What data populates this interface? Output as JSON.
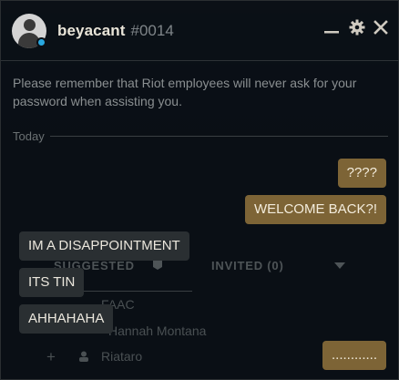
{
  "header": {
    "username": "beyacant",
    "tag": "#0014",
    "status_color": "#29a8e0"
  },
  "controls": {
    "minimize_icon": "minimize-icon",
    "settings_icon": "gear-icon",
    "close_icon": "close-icon"
  },
  "notice": "Please remember that Riot employees will never ask for your password when assisting you.",
  "divider_label": "Today",
  "background_list": {
    "tabs": [
      "SUGGESTED",
      "INVITED (0)"
    ],
    "items": [
      "FAAC",
      "Hannah Montana",
      "Riataro"
    ]
  },
  "messages": [
    {
      "direction": "outgoing",
      "text": "????"
    },
    {
      "direction": "outgoing",
      "text": "WELCOME BACK?!"
    },
    {
      "direction": "incoming",
      "text": "IM A DISAPPOINTMENT"
    },
    {
      "direction": "incoming",
      "text": "ITS TIN"
    },
    {
      "direction": "incoming",
      "text": "AHHAHAHA"
    },
    {
      "direction": "outgoing",
      "text": "............"
    }
  ],
  "colors": {
    "outgoing_bubble": "#7d6436",
    "incoming_bubble": "#2a2f32",
    "window_bg": "#0a1016"
  }
}
